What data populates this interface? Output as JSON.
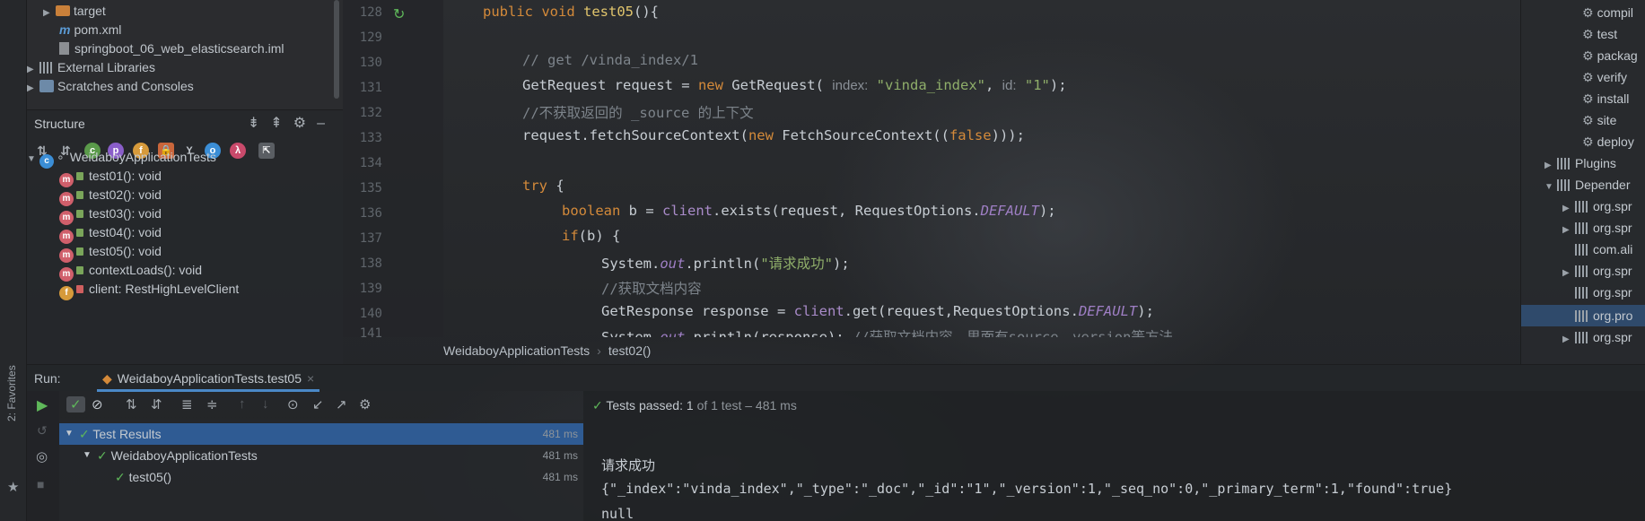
{
  "project_tree": [
    {
      "label": "target",
      "type": "folder"
    },
    {
      "label": "pom.xml",
      "type": "maven"
    },
    {
      "label": "springboot_06_web_elasticsearch.iml",
      "type": "iml"
    },
    {
      "label": "External Libraries",
      "type": "library"
    },
    {
      "label": "Scratches and Consoles",
      "type": "scratch"
    }
  ],
  "structure": {
    "title": "Structure",
    "class_name": "WeidaboyApplicationTests",
    "members": [
      {
        "label": "test01(): void",
        "kind": "m"
      },
      {
        "label": "test02(): void",
        "kind": "m"
      },
      {
        "label": "test03(): void",
        "kind": "m"
      },
      {
        "label": "test04(): void",
        "kind": "m"
      },
      {
        "label": "test05(): void",
        "kind": "m"
      },
      {
        "label": "contextLoads(): void",
        "kind": "m"
      },
      {
        "label": "client: RestHighLevelClient",
        "kind": "f"
      }
    ]
  },
  "editor": {
    "line_numbers": [
      "128",
      "129",
      "130",
      "131",
      "132",
      "133",
      "134",
      "135",
      "136",
      "137",
      "138",
      "139",
      "140",
      "141"
    ],
    "breadcrumb": [
      "WeidaboyApplicationTests",
      "test02()"
    ]
  },
  "maven": {
    "lifecycle": [
      "compil",
      "test",
      "packag",
      "verify",
      "install",
      "site",
      "deploy"
    ],
    "plugins_label": "Plugins",
    "dependencies_label": "Depender",
    "deps": [
      "org.spr",
      "org.spr",
      "com.ali",
      "org.spr",
      "org.spr",
      "org.pro",
      "org.spr"
    ]
  },
  "run": {
    "label": "Run:",
    "tab": "WeidaboyApplicationTests.test05",
    "tests_passed_label": "Tests passed:",
    "tests_passed_count": "1",
    "tests_passed_rest": "of 1 test – 481 ms",
    "results": [
      {
        "label": "Test Results",
        "time": "481 ms"
      },
      {
        "label": "WeidaboyApplicationTests",
        "time": "481 ms"
      },
      {
        "label": "test05()",
        "time": "481 ms"
      }
    ],
    "console": [
      "请求成功",
      "{\"_index\":\"vinda_index\",\"_type\":\"_doc\",\"_id\":\"1\",\"_version\":1,\"_seq_no\":0,\"_primary_term\":1,\"found\":true}",
      "null"
    ]
  },
  "favorites_label": "2: Favorites",
  "colors": {
    "accent": "#4a88c7",
    "selection": "#2f5b93",
    "pass": "#5fb85a"
  }
}
